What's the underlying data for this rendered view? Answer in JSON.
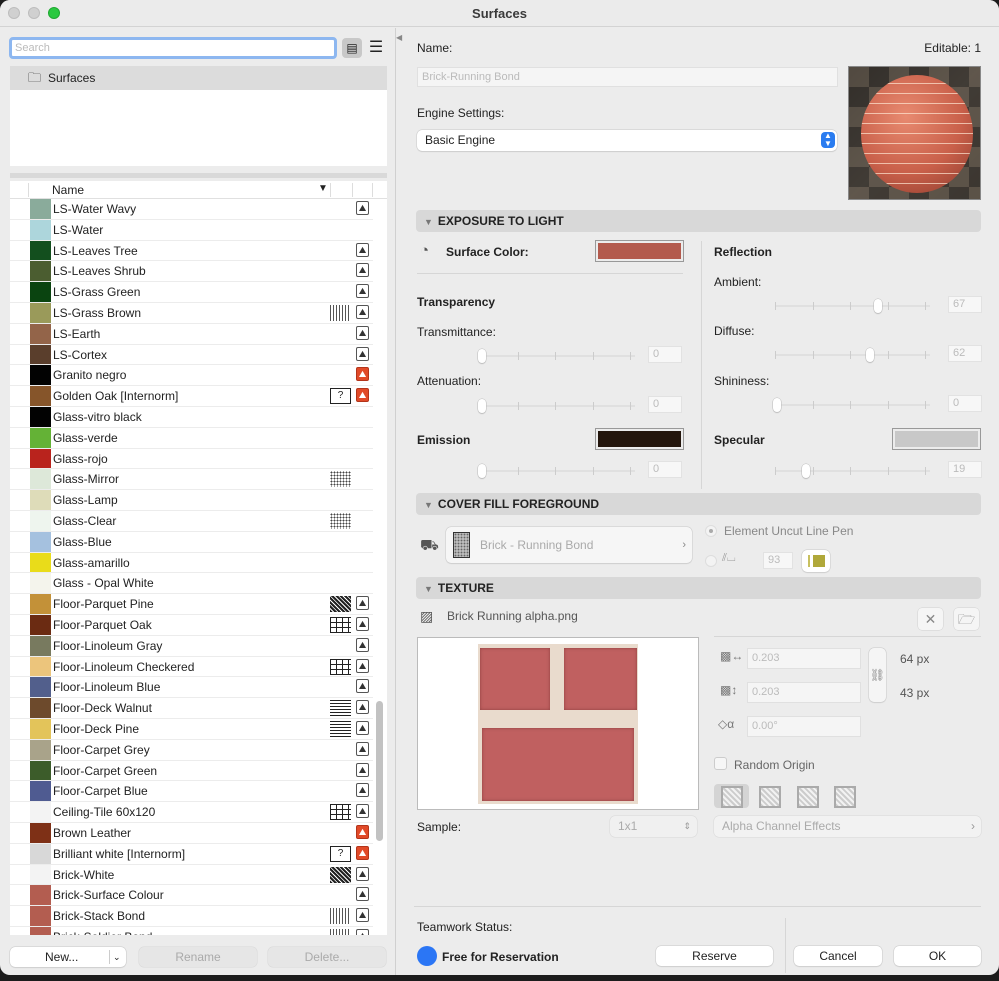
{
  "window": {
    "title": "Surfaces"
  },
  "left": {
    "search_placeholder": "Search",
    "tree": {
      "root_label": "Surfaces"
    },
    "list_header": {
      "name_col": "Name"
    },
    "rows": [
      {
        "name": "LS-Water Wavy",
        "color": "#8aab9b",
        "fill": "",
        "texture": "image"
      },
      {
        "name": "LS-Water",
        "color": "#add6dc",
        "fill": "",
        "texture": ""
      },
      {
        "name": "LS-Leaves Tree",
        "color": "#134f1e",
        "fill": "",
        "texture": "image"
      },
      {
        "name": "LS-Leaves Shrub",
        "color": "#4b5d30",
        "fill": "",
        "texture": "image"
      },
      {
        "name": "LS-Grass Green",
        "color": "#0a4410",
        "fill": "",
        "texture": "image"
      },
      {
        "name": "LS-Grass Brown",
        "color": "#9a9a5a",
        "fill": "vlines",
        "texture": "image"
      },
      {
        "name": "LS-Earth",
        "color": "#936449",
        "fill": "",
        "texture": "image"
      },
      {
        "name": "LS-Cortex",
        "color": "#5a3e2c",
        "fill": "",
        "texture": "image"
      },
      {
        "name": "Granito negro",
        "color": "#020202",
        "fill": "",
        "texture": "missing"
      },
      {
        "name": "Golden Oak [Internorm]",
        "color": "#86552a",
        "fill": "unknown",
        "texture": "missing"
      },
      {
        "name": "Glass-vitro black",
        "color": "#020202",
        "fill": "",
        "texture": ""
      },
      {
        "name": "Glass-verde",
        "color": "#64b236",
        "fill": "",
        "texture": ""
      },
      {
        "name": "Glass-rojo",
        "color": "#b9231d",
        "fill": "",
        "texture": ""
      },
      {
        "name": "Glass-Mirror",
        "color": "#dde8d9",
        "fill": "dots",
        "texture": ""
      },
      {
        "name": "Glass-Lamp",
        "color": "#dedcb9",
        "fill": "",
        "texture": ""
      },
      {
        "name": "Glass-Clear",
        "color": "#eef5ee",
        "fill": "dots",
        "texture": ""
      },
      {
        "name": "Glass-Blue",
        "color": "#a5c1df",
        "fill": "",
        "texture": ""
      },
      {
        "name": "Glass-amarillo",
        "color": "#e9dc1a",
        "fill": "",
        "texture": ""
      },
      {
        "name": "Glass - Opal White",
        "color": "#f4f4ec",
        "fill": "",
        "texture": ""
      },
      {
        "name": "Floor-Parquet Pine",
        "color": "#c39138",
        "fill": "dense",
        "texture": "image"
      },
      {
        "name": "Floor-Parquet Oak",
        "color": "#6b2b12",
        "fill": "grid",
        "texture": "image"
      },
      {
        "name": "Floor-Linoleum Gray",
        "color": "#787a5f",
        "fill": "",
        "texture": "image"
      },
      {
        "name": "Floor-Linoleum Checkered",
        "color": "#ecc57c",
        "fill": "grid",
        "texture": "image"
      },
      {
        "name": "Floor-Linoleum Blue",
        "color": "#525f8c",
        "fill": "",
        "texture": "image"
      },
      {
        "name": "Floor-Deck Walnut",
        "color": "#6d4a2c",
        "fill": "lines",
        "texture": "image"
      },
      {
        "name": "Floor-Deck Pine",
        "color": "#e3c45a",
        "fill": "lines",
        "texture": "image"
      },
      {
        "name": "Floor-Carpet Grey",
        "color": "#a9a38a",
        "fill": "",
        "texture": "image"
      },
      {
        "name": "Floor-Carpet Green",
        "color": "#3c5c2a",
        "fill": "",
        "texture": "image"
      },
      {
        "name": "Floor-Carpet Blue",
        "color": "#4f5b91",
        "fill": "",
        "texture": "image"
      },
      {
        "name": "Ceiling-Tile 60x120",
        "color": "#f3f3f3",
        "fill": "grid",
        "texture": "image"
      },
      {
        "name": "Brown Leather",
        "color": "#7e3016",
        "fill": "",
        "texture": "missing"
      },
      {
        "name": "Brilliant white [Internorm]",
        "color": "#d8d8d8",
        "fill": "unknown",
        "texture": "missing"
      },
      {
        "name": "Brick-White",
        "color": "#f3f3f3",
        "fill": "dense",
        "texture": "image"
      },
      {
        "name": "Brick-Surface Colour",
        "color": "#b35d50",
        "fill": "",
        "texture": "image"
      },
      {
        "name": "Brick-Stack Bond",
        "color": "#b35d50",
        "fill": "vlines",
        "texture": "image"
      },
      {
        "name": "Brick-Soldier Bond",
        "color": "#b35d50",
        "fill": "vlines",
        "texture": "image"
      }
    ],
    "buttons": {
      "new": "New...",
      "rename": "Rename",
      "delete": "Delete..."
    }
  },
  "right": {
    "name_label": "Name:",
    "editable": "Editable: 1",
    "name_value": "Brick-Running Bond",
    "engine_label": "Engine Settings:",
    "engine_value": "Basic Engine",
    "exposure": {
      "title": "EXPOSURE TO LIGHT",
      "surface_color_label": "Surface Color:",
      "surface_color": "#b35a4d",
      "transparency_label": "Transparency",
      "transmittance_label": "Transmittance:",
      "transmittance": 0,
      "attenuation_label": "Attenuation:",
      "attenuation": 0,
      "emission_label": "Emission",
      "emission_color": "#23150c",
      "emission": 0,
      "reflection_label": "Reflection",
      "ambient_label": "Ambient:",
      "ambient": 67,
      "diffuse_label": "Diffuse:",
      "diffuse": 62,
      "shininess_label": "Shininess:",
      "shininess": 0,
      "specular_label": "Specular",
      "specular_color": "#c8c8c8",
      "specular": 19
    },
    "cover_fill": {
      "title": "COVER FILL FOREGROUND",
      "fill_name": "Brick - Running Bond",
      "option1": "Element Uncut Line Pen",
      "pen_number": "93",
      "pen_color": "#b0a83a"
    },
    "texture": {
      "title": "TEXTURE",
      "file_name": "Brick Running alpha.png",
      "width": "0.203",
      "height": "0.203",
      "angle": "0.00°",
      "px_width": "64 px",
      "px_height": "43 px",
      "random_origin": "Random Origin",
      "sample_label": "Sample:",
      "sample_value": "1x1",
      "alpha_effects": "Alpha Channel Effects"
    },
    "teamwork": {
      "label": "Teamwork Status:",
      "status": "Free for Reservation",
      "status_color": "#2b76f5"
    },
    "buttons": {
      "reserve": "Reserve",
      "cancel": "Cancel",
      "ok": "OK"
    }
  }
}
